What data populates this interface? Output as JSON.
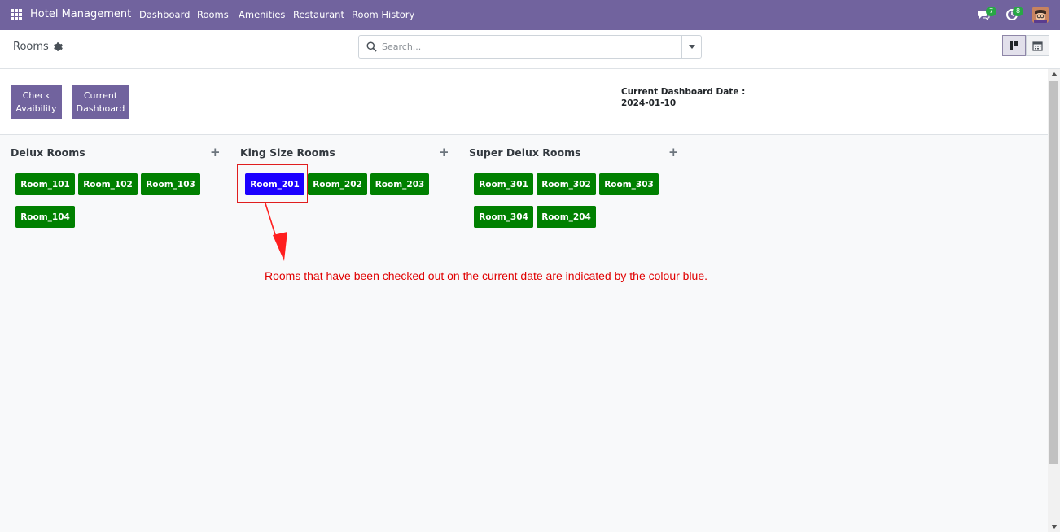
{
  "navbar": {
    "brand": "Hotel Management",
    "menu": [
      "Dashboard",
      "Rooms",
      "Amenities",
      "Restaurant",
      "Room History"
    ],
    "messages_count": "7",
    "activities_count": "8",
    "icons": [
      "apps-icon",
      "chat-icon",
      "clock-icon",
      "avatar"
    ]
  },
  "control_panel": {
    "breadcrumb": "Rooms",
    "search_placeholder": "Search...",
    "views": [
      "kanban",
      "calendar"
    ],
    "active_view": "kanban"
  },
  "dashboard": {
    "check_button": "Check\nAvaibility",
    "current_button": "Current\nDashboard",
    "date_label": "Current Dashboard Date :",
    "date_value": "2024-01-10"
  },
  "columns": [
    {
      "title": "Delux Rooms",
      "rooms": [
        "Room_101",
        "Room_102",
        "Room_103",
        "Room_104"
      ]
    },
    {
      "title": "King Size Rooms",
      "rooms": [
        "Room_201",
        "Room_202",
        "Room_203"
      ]
    },
    {
      "title": "Super Delux Rooms",
      "rooms": [
        "Room_301",
        "Room_302",
        "Room_303",
        "Room_304",
        "Room_204"
      ]
    }
  ],
  "room_status": {
    "checked_out_rooms": [
      "Room_201"
    ],
    "checked_out_color": "#1b00ff",
    "available_color": "#008000"
  },
  "annotation": "Rooms that have been checked out on the current date are indicated by the colour blue.",
  "colors": {
    "brand": "#71639e",
    "annotation": "#e00000"
  }
}
